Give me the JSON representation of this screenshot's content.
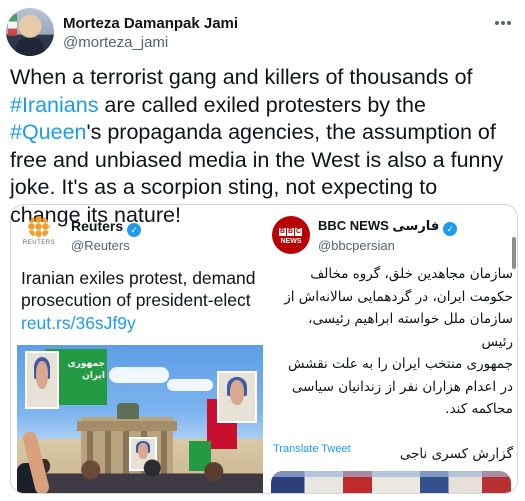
{
  "tweet": {
    "display_name": "Morteza Damanpak Jami",
    "handle": "@morteza_jami",
    "text_parts": {
      "p1": "When a terrorist gang and killers of thousands of ",
      "hashtag1": "#Iranians",
      "p2": " are called exiled protesters by the ",
      "hashtag2": "#Queen",
      "p3": "'s propaganda agencies, the assumption of free and unbiased media in the West is also a funny joke. It's as a scorpion sting, not expecting to change its nature!"
    }
  },
  "embedded_left": {
    "account_name": "Reuters",
    "account_handle": "@Reuters",
    "logo_word": "REUTERS",
    "headline": "Iranian exiles protest, demand prosecution of president-elect",
    "link": "reut.rs/36sJf9y",
    "photo_banner_text": "جمهوری ایران"
  },
  "embedded_right": {
    "account_name": "BBC NEWS فارسی",
    "account_handle": "@bbcpersian",
    "logo_blocks": [
      "B",
      "B",
      "C"
    ],
    "logo_news": "NEWS",
    "body_lines": [
      "سازمان مجاهدین خلق، گروه مخالف",
      "حکومت ایران، در گردهمایی سالانه‌اش از",
      "سازمان ملل خواسته ابراهیم رئیسی، رئیس",
      "جمهوری منتخب ایران را به علت نقشش",
      "در اعدام هزاران نفر از زندانیان سیاسی",
      "محاکمه کند."
    ],
    "signature": "گزارش کسری ناجی",
    "translate_label": "Translate Tweet"
  },
  "colors": {
    "accent": "#1d9bf0",
    "text": "#0f1419",
    "secondary": "#536471",
    "border": "#cfd9de"
  }
}
